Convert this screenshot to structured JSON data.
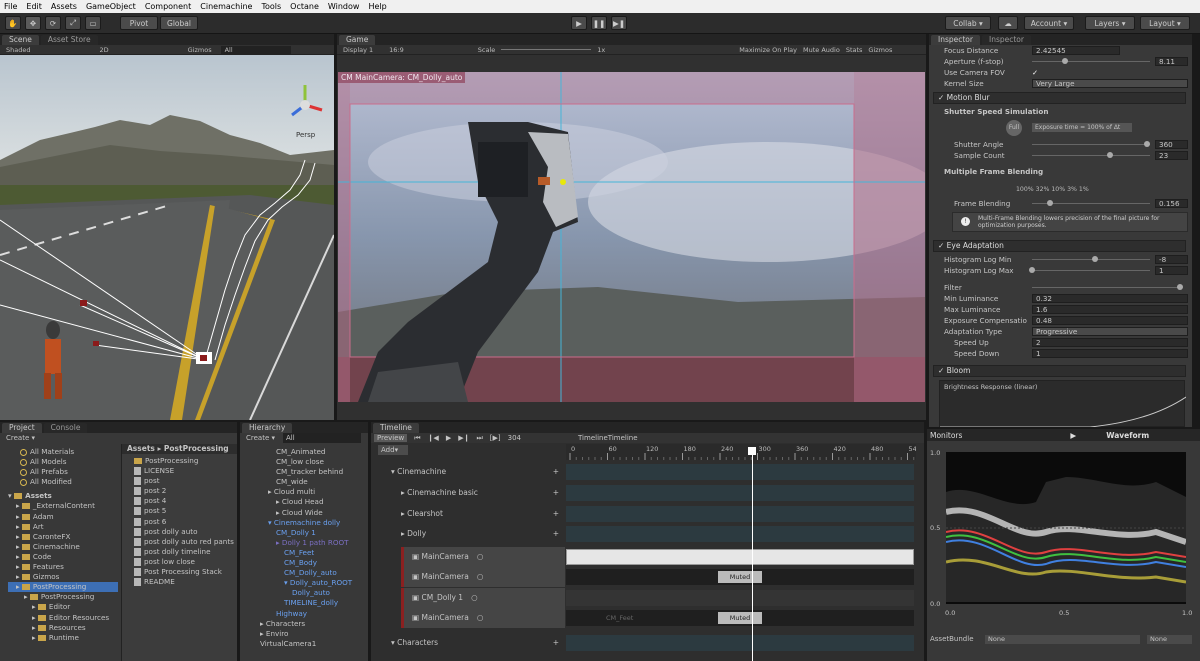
{
  "menu": [
    "File",
    "Edit",
    "Assets",
    "GameObject",
    "Component",
    "Cinemachine",
    "Tools",
    "Octane",
    "Window",
    "Help"
  ],
  "toolbar": {
    "pivot": "Pivot",
    "global": "Global",
    "collab": "Collab",
    "account": "Account",
    "layers": "Layers",
    "layout": "Layout"
  },
  "scene": {
    "tabs": [
      "Scene",
      "Asset Store"
    ],
    "shaded": "Shaded",
    "mode2d": "2D",
    "gizmos": "Gizmos",
    "search": "All",
    "persp": "Persp"
  },
  "game": {
    "tab": "Game",
    "display": "Display 1",
    "aspect": "16:9",
    "scale": "Scale",
    "scale_value": "1x",
    "options": [
      "Maximize On Play",
      "Mute Audio",
      "Stats",
      "Gizmos"
    ],
    "camera_label": "CM MainCamera: CM_Dolly_auto"
  },
  "inspector": {
    "tabs": [
      "Inspector",
      "Inspector"
    ],
    "rows_top": [
      {
        "label": "Focus Distance",
        "value": "2.42545"
      },
      {
        "label": "Aperture (f-stop)",
        "value": "8.11"
      },
      {
        "label": "Use Camera FOV",
        "value": "✓"
      },
      {
        "label": "Kernel Size",
        "value": "Very Large"
      }
    ],
    "motion_blur": "Motion Blur",
    "shutter_sim": "Shutter Speed Simulation",
    "full_btn": "Full",
    "exposure_btn": "Exposure time = 100% of Δt",
    "shutter_angle": "Shutter Angle",
    "shutter_angle_val": "360",
    "sample_count": "Sample Count",
    "sample_count_val": "23",
    "multi_frame": "Multiple Frame Blending",
    "blend_pcts": "100%  32%  10%   3%    1%",
    "frame_blending": "Frame Blending",
    "frame_blending_val": "0.156",
    "note": "Multi-Frame Blending lowers precision of the final picture for optimization purposes.",
    "eye": "Eye Adaptation",
    "histo_min": "Histogram Log Min",
    "histo_min_val": "-8",
    "histo_max": "Histogram Log Max",
    "histo_max_val": "1",
    "filter": "Filter",
    "min_lum": "Min Luminance",
    "min_lum_val": "0.32",
    "max_lum": "Max Luminance",
    "max_lum_val": "1.6",
    "exp_comp": "Exposure Compensatio",
    "exp_comp_val": "0.48",
    "adapt_type": "Adaptation Type",
    "adapt_type_val": "Progressive",
    "speed_up": "Speed Up",
    "speed_up_val": "2",
    "speed_down": "Speed Down",
    "speed_down_val": "1",
    "bloom": "Bloom",
    "brightness": "Brightness Response (linear)"
  },
  "monitors": {
    "title": "Monitors",
    "mode": "Waveform",
    "y_ticks": [
      "1.0",
      "0.5",
      "0.0"
    ],
    "x_ticks": [
      "0.0",
      "0.5",
      "1.0"
    ],
    "asset_bundle": "AssetBundle",
    "none1": "None",
    "none2": "None"
  },
  "project": {
    "tabs": [
      "Project",
      "Console"
    ],
    "create": "Create",
    "favorites": [
      "All Materials",
      "All Models",
      "All Prefabs",
      "All Modified"
    ],
    "assets_root": "Assets",
    "folders": [
      "_ExternalContent",
      "Adam",
      "Art",
      "CaronteFX",
      "Cinemachine",
      "Code",
      "Features",
      "Gizmos",
      "PostProcessing",
      "PostProcessing",
      "Editor",
      "Editor Resources",
      "Resources",
      "Runtime"
    ],
    "breadcrumb": [
      "Assets",
      "PostProcessing"
    ],
    "files": [
      "PostProcessing",
      "LICENSE",
      "post",
      "post 2",
      "post 4",
      "post 5",
      "post 6",
      "post dolly auto",
      "post dolly auto red pants",
      "post dolly timeline",
      "post low close",
      "Post Processing Stack",
      "README"
    ]
  },
  "hierarchy": {
    "tab": "Hierarchy",
    "create": "Create",
    "search": "All",
    "items": [
      "CM_Animated",
      "CM_low close",
      "CM_tracker behind",
      "CM_wide",
      "Cloud multi",
      "Cloud Head",
      "Cloud Wide",
      "Cinemachine dolly",
      "CM_Dolly 1",
      "Dolly 1 path ROOT",
      "CM_Feet",
      "CM_Body",
      "CM_Dolly_auto",
      "Dolly_auto_ROOT",
      "Dolly_auto",
      "TIMELINE_dolly",
      "Highway",
      "Characters",
      "Enviro",
      "VirtualCamera1"
    ]
  },
  "timeline": {
    "tab": "Timeline",
    "preview": "Preview",
    "frame": "304",
    "name": "TimelineTimeline",
    "add": "Add",
    "ticks": [
      "0",
      "60",
      "120",
      "180",
      "240",
      "300",
      "360",
      "420",
      "480",
      "540"
    ],
    "tracks": [
      "Cinemachine",
      "Cinemachine basic",
      "Clearshot",
      "Dolly",
      "MainCamera",
      "MainCamera",
      "CM_Dolly 1",
      "MainCamera",
      "Characters"
    ],
    "muted": "Muted",
    "cm_feet": "CM_Feet"
  },
  "colors": {
    "accent": "#3d6fb5",
    "ground": "#4c4f4f",
    "sky": "#8a9aa8"
  }
}
